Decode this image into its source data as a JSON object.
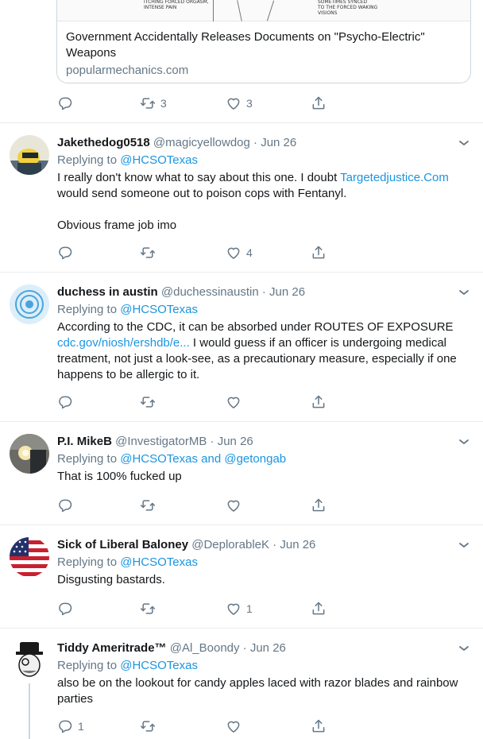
{
  "card": {
    "image_caption_left": "ITCHING   FORCED ORGASM,",
    "image_caption_left2": "INTENSE PAIN",
    "image_caption_right": "SOMETIMES SYNCED",
    "image_caption_right2": "TO THE FORCED WAKING",
    "image_caption_right3": "VISIONS",
    "title": "Government Accidentally Releases Documents on \"Psycho-Electric\" Weapons",
    "domain": "popularmechanics.com"
  },
  "card_actions": {
    "reply": "",
    "retweet": "3",
    "like": "3"
  },
  "tweets": [
    {
      "name": "Jakethedog0518",
      "handle": "@magicyellowdog",
      "date": "Jun 26",
      "replying_prefix": "Replying to ",
      "replying_to": "@HCSOTexas",
      "text_a": "I really don't know what to say about this one. I doubt ",
      "link": "Targetedjustice.Com",
      "text_b": " would send someone out to poison cops with Fentanyl.",
      "text_c": "Obvious frame job imo",
      "counts": {
        "reply": "",
        "retweet": "",
        "like": "4"
      }
    },
    {
      "name": "duchess in austin",
      "handle": "@duchessinaustin",
      "date": "Jun 26",
      "replying_prefix": "Replying to ",
      "replying_to": "@HCSOTexas",
      "text_a": "According to the CDC, it can be absorbed under ROUTES OF EXPOSURE",
      "link": "cdc.gov/niosh/ershdb/e...",
      "text_b": " I would guess if an officer is undergoing medical treatment, not just a look-see, as a precautionary measure, especially if one happens to be allergic to it.",
      "counts": {
        "reply": "",
        "retweet": "",
        "like": ""
      }
    },
    {
      "name": "P.I. MikeB",
      "handle": "@InvestigatorMB",
      "date": "Jun 26",
      "replying_prefix": "Replying to ",
      "replying_to": "@HCSOTexas",
      "replying_and": " and ",
      "replying_to2": "@getongab",
      "text_a": "That is 100% fucked up",
      "counts": {
        "reply": "",
        "retweet": "",
        "like": ""
      }
    },
    {
      "name": "Sick of Liberal Baloney",
      "handle": "@DeplorableK",
      "date": "Jun 26",
      "replying_prefix": "Replying to ",
      "replying_to": "@HCSOTexas",
      "text_a": "Disgusting bastards.",
      "counts": {
        "reply": "",
        "retweet": "",
        "like": "1"
      }
    },
    {
      "name": "Tiddy Ameritrade™",
      "handle": "@Al_Boondy",
      "date": "Jun 26",
      "replying_prefix": "Replying to ",
      "replying_to": "@HCSOTexas",
      "text_a": "also be on the lookout for candy apples laced with razor blades and rainbow parties",
      "counts": {
        "reply": "1",
        "retweet": "",
        "like": ""
      }
    }
  ],
  "separator": " · ",
  "icons": [
    "reply-icon",
    "retweet-icon",
    "like-icon",
    "share-icon",
    "chevron-down-icon"
  ],
  "colors": {
    "link": "#1b95e0",
    "muted": "#657786",
    "border": "#e6ecf0"
  }
}
